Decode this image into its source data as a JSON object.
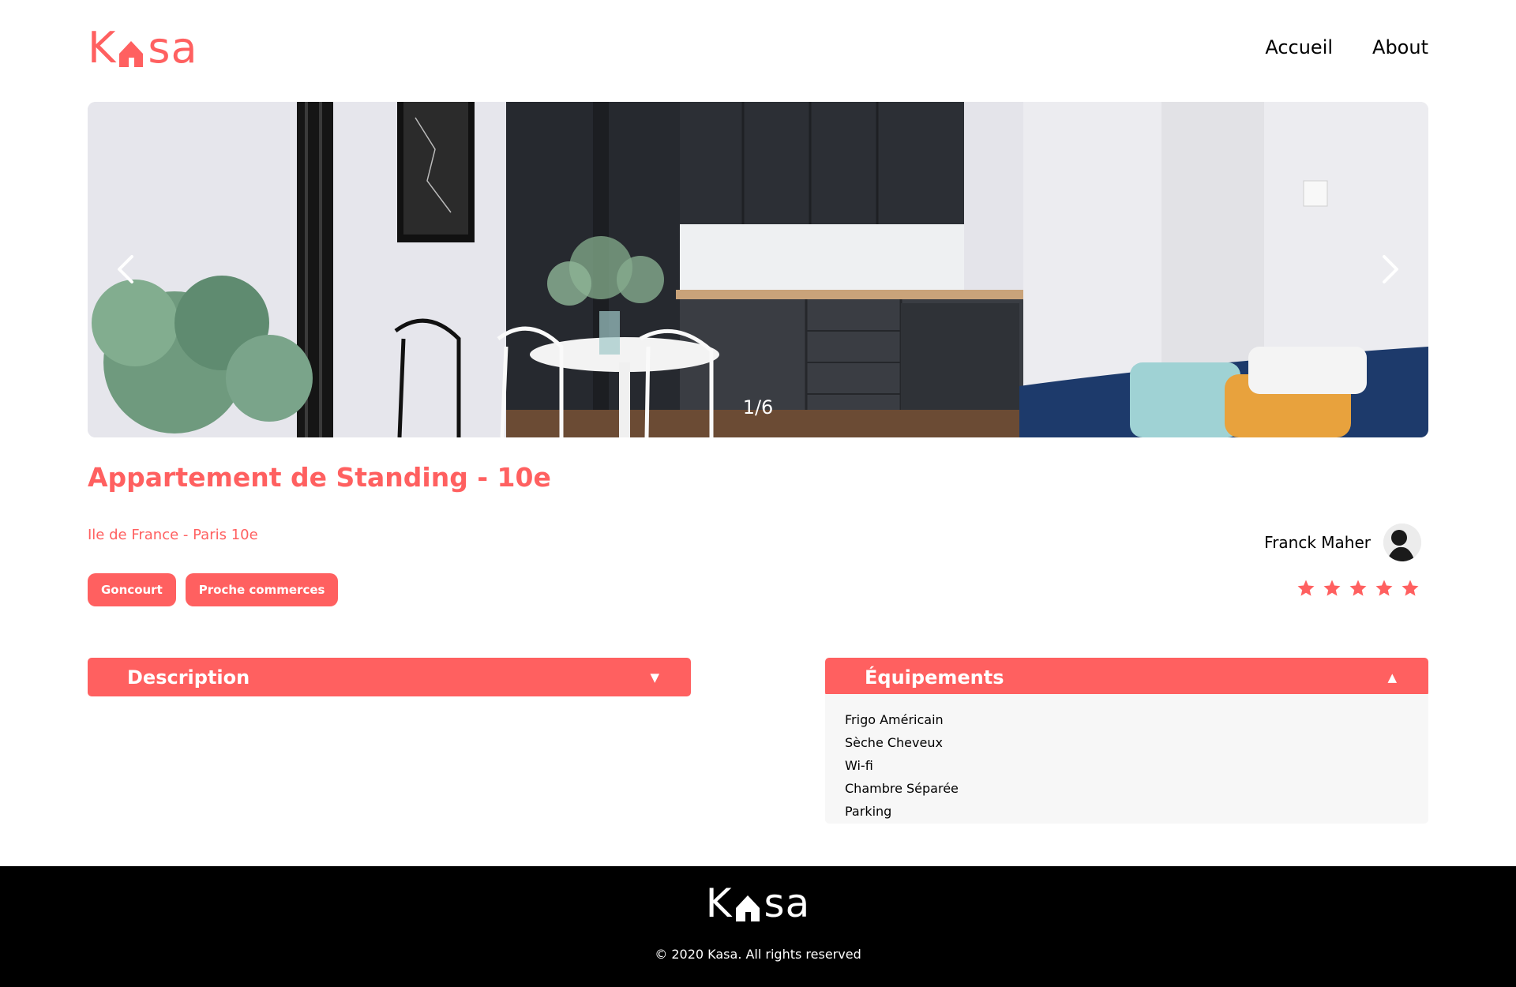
{
  "brand": {
    "name_part1": "K",
    "name_part2": "sa",
    "accent_color": "#FF6060"
  },
  "nav": {
    "items": [
      "Accueil",
      "About"
    ]
  },
  "gallery": {
    "counter": "1/6",
    "prev_icon": "chevron-left-icon",
    "next_icon": "chevron-right-icon"
  },
  "listing": {
    "title": "Appartement de Standing - 10e",
    "location": "Ile de France - Paris 10e",
    "tags": [
      "Goncourt",
      "Proche commerces"
    ],
    "host_name": "Franck Maher",
    "rating": 5,
    "rating_max": 5
  },
  "collapses": {
    "description": {
      "title": "Description",
      "caret": "▼"
    },
    "equipements": {
      "title": "Équipements",
      "caret": "▲",
      "items": [
        "Frigo Américain",
        "Sèche Cheveux",
        "Wi-fi",
        "Chambre Séparée",
        "Parking"
      ]
    }
  },
  "footer": {
    "copyright": "© 2020 Kasa. All rights reserved"
  }
}
